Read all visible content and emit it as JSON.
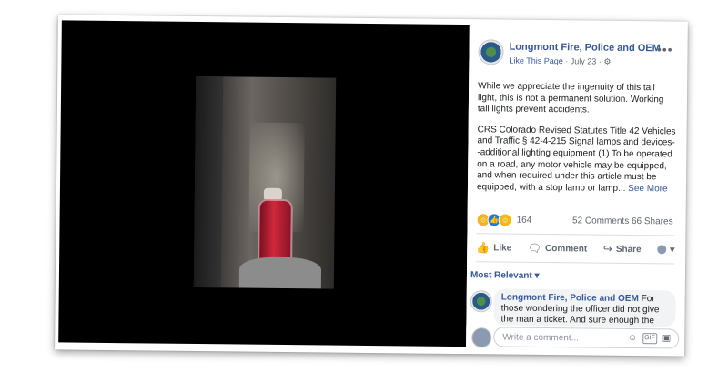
{
  "post": {
    "page_name": "Longmont Fire, Police and OEM",
    "like_page": "Like This Page",
    "separator": " · ",
    "date": "July 23",
    "date_suffix": " · ",
    "globe_icon": "globe-icon",
    "more": "•••",
    "paragraph1": "While we appreciate the ingenuity of this tail light, this is not a permanent solution. Working tail lights prevent accidents.",
    "paragraph2": "CRS Colorado Revised Statutes Title 42 Vehicles and Traffic § 42-4-215 Signal lamps and devices--additional lighting equipment (1) To be operated on a road, any motor vehicle may be equipped, and when required under this article must be equipped, with a stop lamp or lamp...",
    "see_more": " See More"
  },
  "engagement": {
    "reaction_count": "164",
    "comments": "52 Comments",
    "shares": "66 Shares"
  },
  "actions": {
    "like": "Like",
    "comment": "Comment",
    "share": "Share"
  },
  "comments": {
    "sort_label": "Most Relevant ▾",
    "first": {
      "author": "Longmont Fire, Police and OEM",
      "text": " For those wondering the officer did not give the man a ticket. And sure enough the"
    },
    "write_placeholder": "Write a comment..."
  },
  "icons": {
    "gif": "GIF"
  }
}
